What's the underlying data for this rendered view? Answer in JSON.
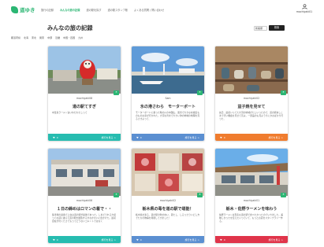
{
  "header": {
    "logo_text": "道ゆき",
    "nav": [
      {
        "label": "旅行の記録",
        "active": false
      },
      {
        "label": "みんなの旅の記録",
        "active": true
      },
      {
        "label": "道の駅を探す",
        "active": false
      },
      {
        "label": "道の駅スタンプ帳",
        "active": false
      },
      {
        "label": "よくある質問 / 問い合わせ",
        "active": false
      }
    ],
    "user_name": "mochiyaki01"
  },
  "page_title": "みんなの旅の記録",
  "sort": {
    "selected": "新着順",
    "button_label": "検索"
  },
  "filters": [
    "都道府県",
    "北海",
    "東北",
    "関東",
    "中部",
    "近畿",
    "中国・四国",
    "九州"
  ],
  "colors": {
    "brand": "#2bb673",
    "footer_teal": "#27bcb0",
    "footer_blue": "#5b8fd1",
    "footer_orange": "#f07c2e",
    "footer_red": "#e0344a"
  },
  "cards": [
    {
      "user": "mochiyaki08",
      "user_sub": "",
      "title": "道の駅てすぎ",
      "desc": "中華系ラーメン旨いねだわたしって",
      "footer_left": "0",
      "footer_right": "旅行を見る >",
      "footer_color": "teal",
      "photo": "daruma-station"
    },
    {
      "user": "Sam",
      "user_sub": "",
      "title": "氷の港さわら　モーターボート",
      "desc": "モーターボードに乗った時の川の中国山。風景で大きな水族館ものものお家が行かれた。大河な湾まで大きい沖の地域の地理を見るさきよって、",
      "footer_left": "0",
      "footer_right": "旅行を見る >",
      "footer_color": "blue",
      "photo": "harbor"
    },
    {
      "user": "mochiyaki02",
      "user_sub": "",
      "title": "益子焼を見せて",
      "desc": "先日、最初いってた大河の地域がたしいったので、道の駅あしこまで行い機会を見せて見よ。一部品のも見ようりにかおばかり行った、",
      "footer_left": "0",
      "footer_right": "旅行を見る >",
      "footer_color": "orange",
      "photo": "pottery"
    },
    {
      "user": "mochiyaki06",
      "user_sub": "",
      "title": "１日の締めはロマンの着で・・",
      "desc": "集車場の最寄で上台は道の駅が最後であった。しまどりれる大使ってお話に誰らえ道の駅を観覧するかなかのいに出かけた。最初自在が付くたさでもってどうないコメントではなく",
      "footer_left": "0",
      "footer_right": "旅行を見る >",
      "footer_color": "teal",
      "photo": "station-building"
    },
    {
      "user": "mochiyaki02",
      "user_sub": "",
      "title": "栃木県の毒を道の駅で堪能！",
      "desc": "栃木県を新る、道の駅の吹の向い、思たし、しるったりいどし方でたちの物事を堪能してきました！",
      "footer_left": "0",
      "footer_right": "旅行を見る >",
      "footer_color": "blue",
      "photo": "market"
    },
    {
      "user": "mochiyaki01",
      "user_sub": "",
      "title": "栃木・佐野ラーメンを味わう",
      "desc": "佐野ラーメンは有名な道の駅で食べたかったのでいきました。美味しかったを伝えたいっていて、もっとお店をスタンプラリー作る。",
      "footer_left": "0",
      "footer_right": "旅行を見る >",
      "footer_color": "red",
      "photo": "roadside-station"
    }
  ]
}
